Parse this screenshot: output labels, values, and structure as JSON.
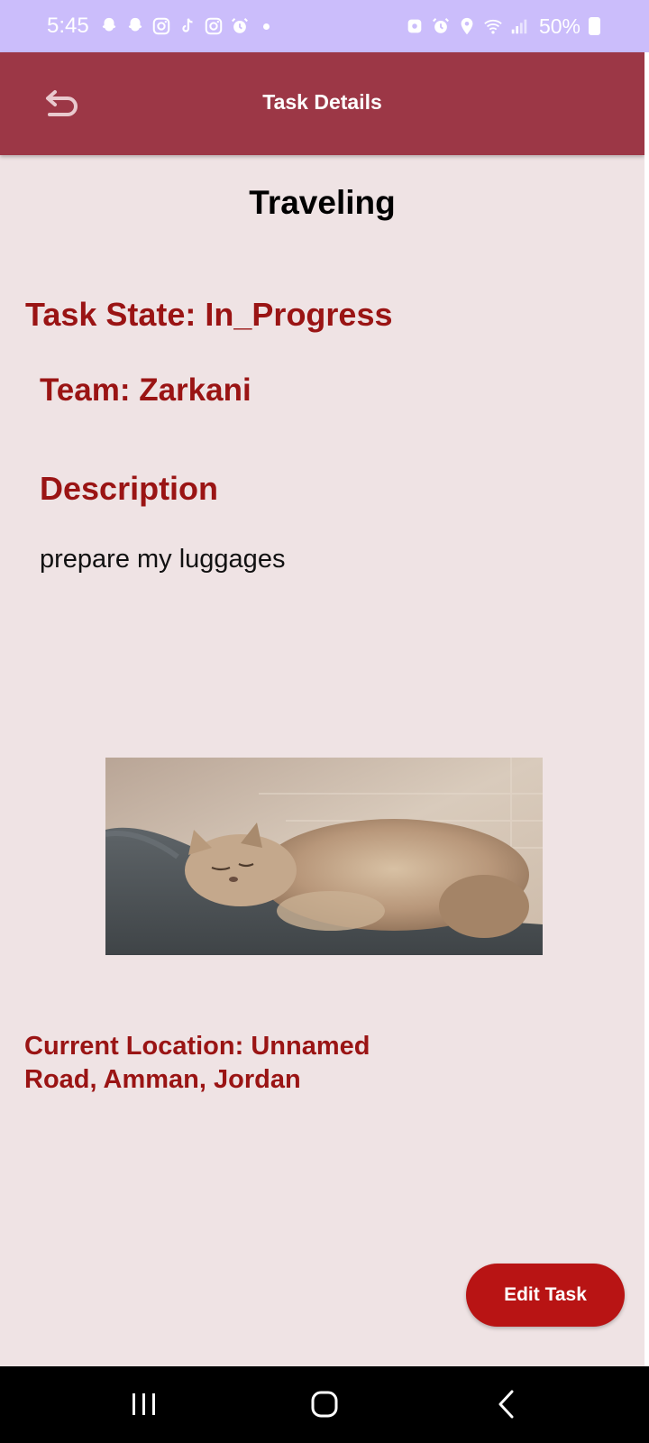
{
  "status_bar": {
    "time": "5:45",
    "battery": "50%",
    "left_icons": [
      "snapchat-icon",
      "snapchat-icon",
      "instagram-icon",
      "tiktok-icon",
      "instagram-icon",
      "alarm-icon"
    ],
    "right_icons": [
      "app-icon",
      "alarm-icon",
      "location-icon",
      "wifi-icon",
      "signal-icon",
      "battery-icon"
    ]
  },
  "app_bar": {
    "title": "Task Details",
    "back_icon": "undo-back-icon",
    "background": "#9c3746"
  },
  "task": {
    "title": "Traveling",
    "state_line": "Task State: In_Progress",
    "team_line": "Team: Zarkani",
    "description_label": "Description",
    "description": "prepare my luggages",
    "image": "photo of a fluffy cat sleeping on a gray couch",
    "location_line": "Current Location: Unnamed Road, Amman, Jordan"
  },
  "actions": {
    "edit_label": "Edit Task",
    "accent": "#b81414"
  },
  "nav_bar": {
    "icons": [
      "recents-icon",
      "home-icon",
      "back-icon"
    ]
  }
}
